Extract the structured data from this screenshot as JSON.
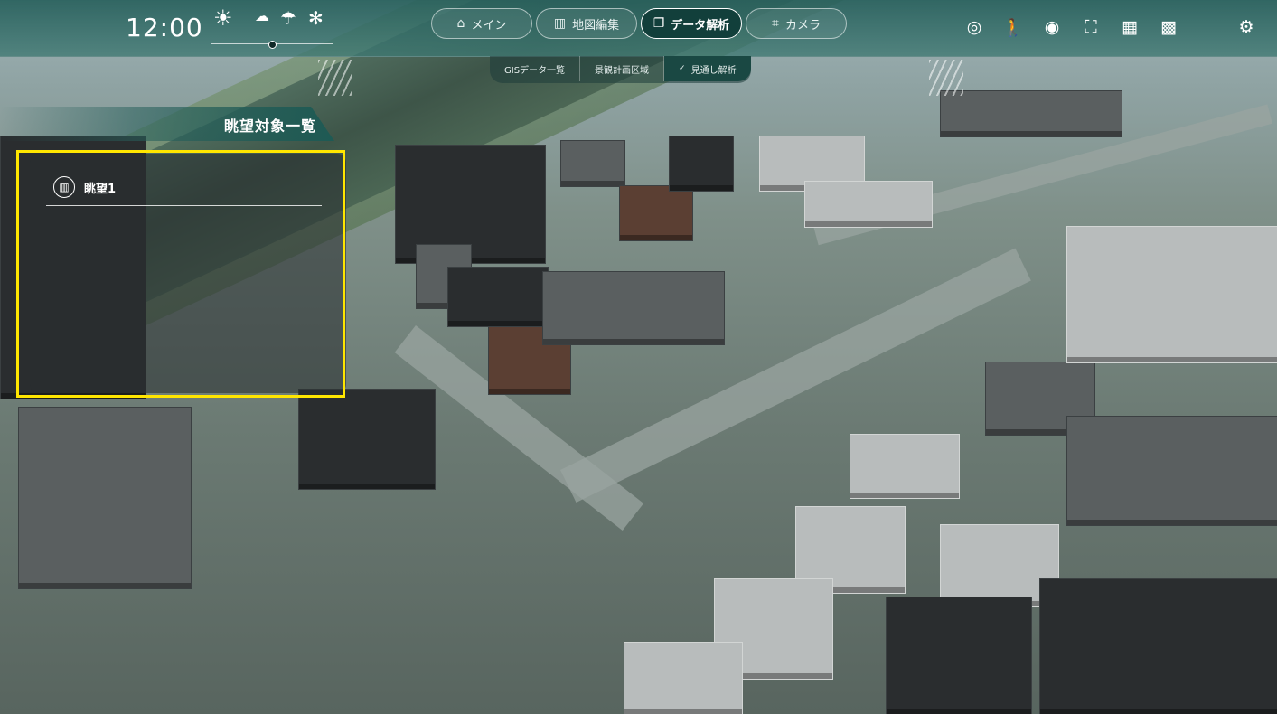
{
  "clock": {
    "time": "12:00"
  },
  "weather": {
    "options": [
      {
        "icon": "sun-icon",
        "glyph": "☀",
        "selected": true
      },
      {
        "icon": "cloud-icon",
        "glyph": "☁"
      },
      {
        "icon": "umbrella-icon",
        "glyph": "☂"
      },
      {
        "icon": "snow-icon",
        "glyph": "✻"
      }
    ]
  },
  "nav": {
    "main": [
      {
        "label": "メイン",
        "icon": "home-icon",
        "glyph": "⌂"
      },
      {
        "label": "地図編集",
        "icon": "building-icon",
        "glyph": "▥"
      },
      {
        "label": "データ解析",
        "icon": "layers-icon",
        "glyph": "❐",
        "active": true
      },
      {
        "label": "カメラ",
        "icon": "camera-icon",
        "glyph": "⌗"
      }
    ],
    "sub": [
      {
        "label": "GISデータ一覧"
      },
      {
        "label": "景観計画区域"
      },
      {
        "label": "見通し解析",
        "check": "✓",
        "active": true
      }
    ]
  },
  "tools": [
    {
      "icon": "location-view-icon",
      "glyph": "◎"
    },
    {
      "icon": "walk-icon",
      "glyph": "🚶"
    },
    {
      "icon": "eye-icon",
      "glyph": "◉"
    },
    {
      "icon": "fit-view-icon",
      "glyph": "⛶"
    },
    {
      "icon": "buildings-icon",
      "glyph": "▦"
    },
    {
      "icon": "texture-icon",
      "glyph": "▩"
    },
    {
      "icon": "settings-icon",
      "glyph": "⚙"
    }
  ],
  "panel": {
    "title": "眺望対象一覧",
    "items": [
      {
        "label": "眺望1",
        "icon": "building-icon",
        "glyph": "▥"
      }
    ]
  },
  "colors": {
    "topbar": "#2c6a65",
    "active_nav": "#123f3b",
    "highlight": "#ffe600"
  }
}
